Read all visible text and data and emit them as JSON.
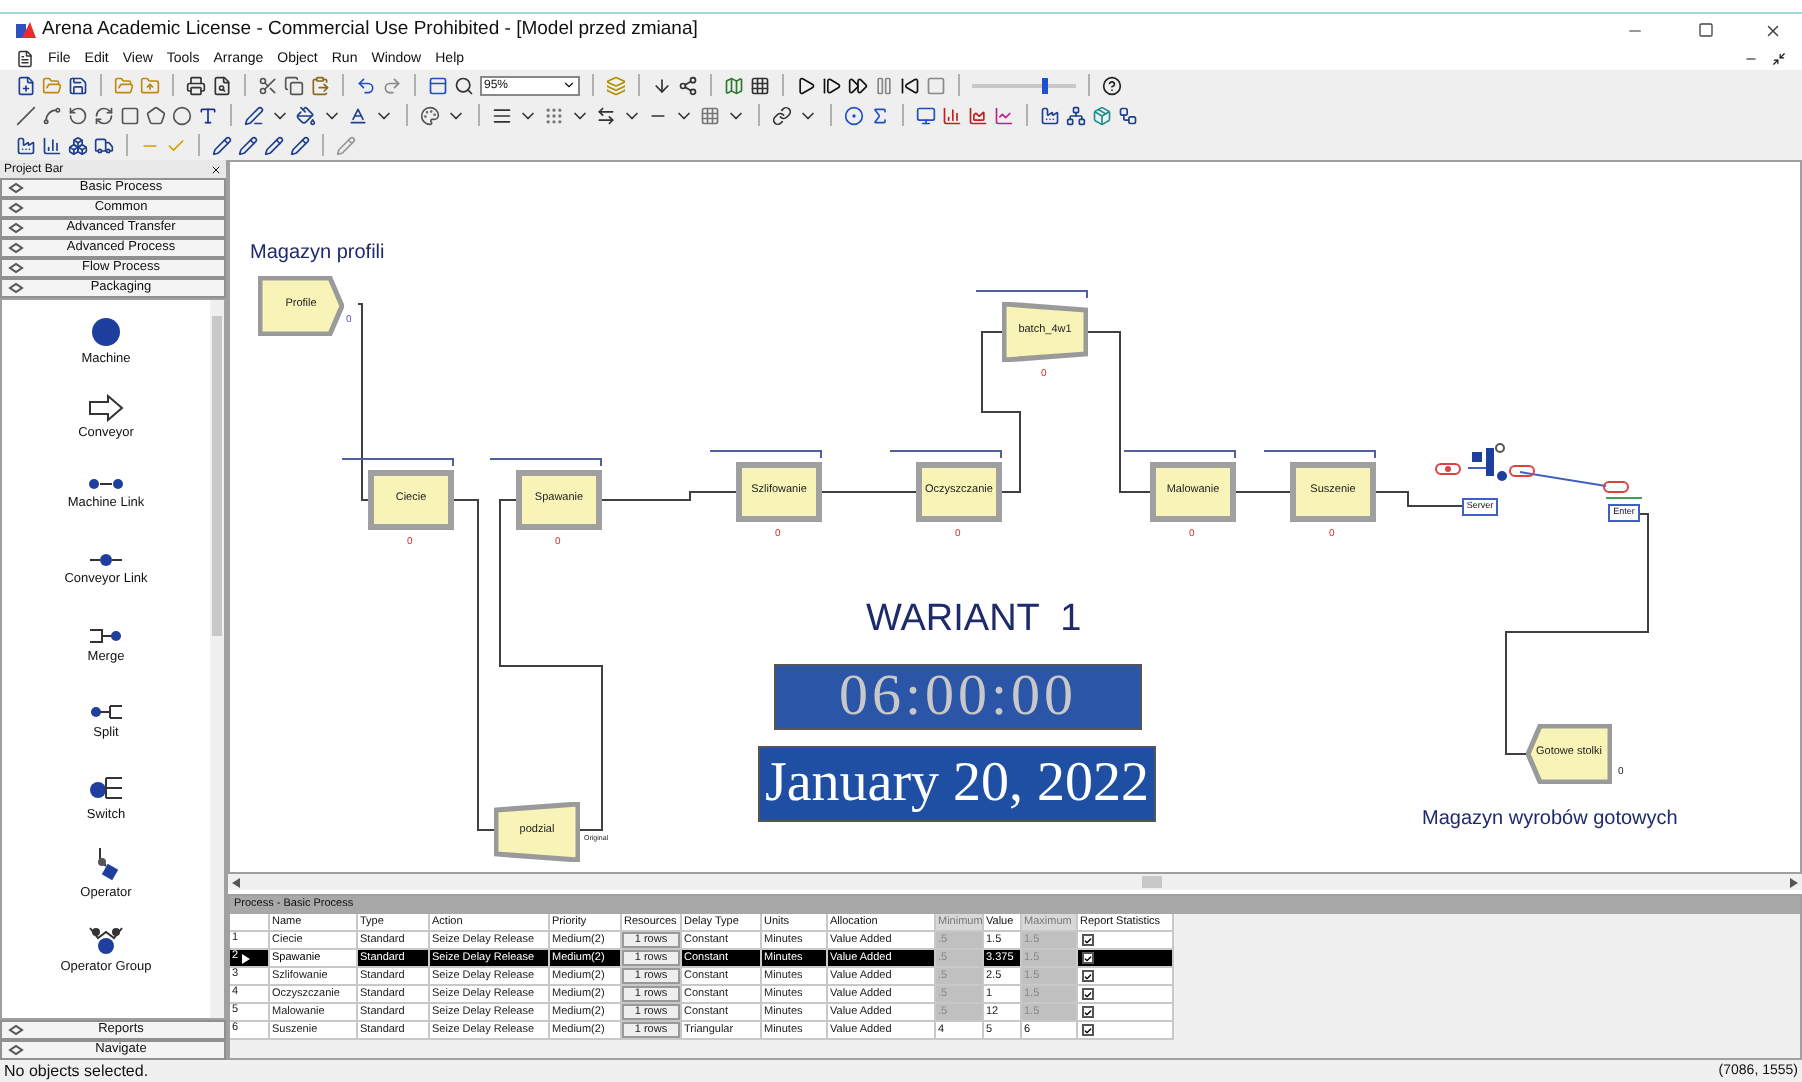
{
  "window": {
    "title": "Arena Academic License - Commercial Use Prohibited - [Model przed zmiana]"
  },
  "menu": [
    "File",
    "Edit",
    "View",
    "Tools",
    "Arrange",
    "Object",
    "Run",
    "Window",
    "Help"
  ],
  "toolbar": {
    "zoom": "95%",
    "speed": {
      "level": 0.7
    }
  },
  "project_bar": {
    "title": "Project Bar",
    "panels": [
      "Basic Process",
      "Common",
      "Advanced Transfer",
      "Advanced Process",
      "Flow Process",
      "Packaging"
    ],
    "items": [
      "Machine",
      "Conveyor",
      "Machine Link",
      "Conveyor Link",
      "Merge",
      "Split",
      "Switch",
      "Operator",
      "Operator Group"
    ],
    "bottom": [
      "Reports",
      "Navigate"
    ]
  },
  "canvas": {
    "titles": [
      "Magazyn profili",
      "Magazyn wyrobów gotowych"
    ],
    "variant": "WARIANT  1",
    "clock": "06:00:00",
    "date": "January 20, 2022",
    "modules": [
      {
        "kind": "create",
        "label": "Profile",
        "counter": "0"
      },
      {
        "kind": "process",
        "label": "Ciecie",
        "counter": "0"
      },
      {
        "kind": "process",
        "label": "Spawanie",
        "counter": "0"
      },
      {
        "kind": "process",
        "label": "Szlifowanie",
        "counter": "0"
      },
      {
        "kind": "process",
        "label": "Oczyszczanie",
        "counter": "0"
      },
      {
        "kind": "batch",
        "label": "batch_4w1",
        "counter": "0"
      },
      {
        "kind": "process",
        "label": "Malowanie",
        "counter": "0"
      },
      {
        "kind": "process",
        "label": "Suszenie",
        "counter": "0"
      },
      {
        "kind": "separate",
        "label": "podzial",
        "exit_label": "Original"
      },
      {
        "kind": "dispose",
        "label": "Gotowe stolki",
        "counter": "0"
      }
    ],
    "devices": [
      {
        "kind": "server",
        "label": "Server"
      },
      {
        "kind": "enter",
        "label": "Enter"
      }
    ]
  },
  "table": {
    "title": "Process - Basic Process",
    "columns": [
      "Name",
      "Type",
      "Action",
      "Priority",
      "Resources",
      "Delay Type",
      "Units",
      "Allocation",
      "Minimum",
      "Value",
      "Maximum",
      "Report Statistics"
    ],
    "rows": [
      {
        "number": "1",
        "cells": [
          "Ciecie",
          "Standard",
          "Seize Delay Release",
          "Medium(2)",
          "1 rows",
          "Constant",
          "Minutes",
          "Value Added",
          ".5",
          "1.5",
          "1.5"
        ],
        "range_disabled": true,
        "report_statistics": true,
        "selected": false
      },
      {
        "number": "2",
        "cells": [
          "Spawanie",
          "Standard",
          "Seize Delay Release",
          "Medium(2)",
          "1 rows",
          "Constant",
          "Minutes",
          "Value Added",
          ".5",
          "3.375",
          "1.5"
        ],
        "range_disabled": true,
        "report_statistics": true,
        "selected": true
      },
      {
        "number": "3",
        "cells": [
          "Szlifowanie",
          "Standard",
          "Seize Delay Release",
          "Medium(2)",
          "1 rows",
          "Constant",
          "Minutes",
          "Value Added",
          ".5",
          "2.5",
          "1.5"
        ],
        "range_disabled": true,
        "report_statistics": true,
        "selected": false
      },
      {
        "number": "4",
        "cells": [
          "Oczyszczanie",
          "Standard",
          "Seize Delay Release",
          "Medium(2)",
          "1 rows",
          "Constant",
          "Minutes",
          "Value Added",
          ".5",
          "1",
          "1.5"
        ],
        "range_disabled": true,
        "report_statistics": true,
        "selected": false
      },
      {
        "number": "5",
        "cells": [
          "Malowanie",
          "Standard",
          "Seize Delay Release",
          "Medium(2)",
          "1 rows",
          "Constant",
          "Minutes",
          "Value Added",
          ".5",
          "12",
          "1.5"
        ],
        "range_disabled": true,
        "report_statistics": true,
        "selected": false
      },
      {
        "number": "6",
        "cells": [
          "Suszenie",
          "Standard",
          "Seize Delay Release",
          "Medium(2)",
          "1 rows",
          "Triangular",
          "Minutes",
          "Value Added",
          "4",
          "5",
          "6"
        ],
        "range_disabled": false,
        "report_statistics": true,
        "selected": false
      }
    ]
  },
  "status_bar": {
    "message": "No objects selected.",
    "coordinates": "(7086, 1555)"
  }
}
